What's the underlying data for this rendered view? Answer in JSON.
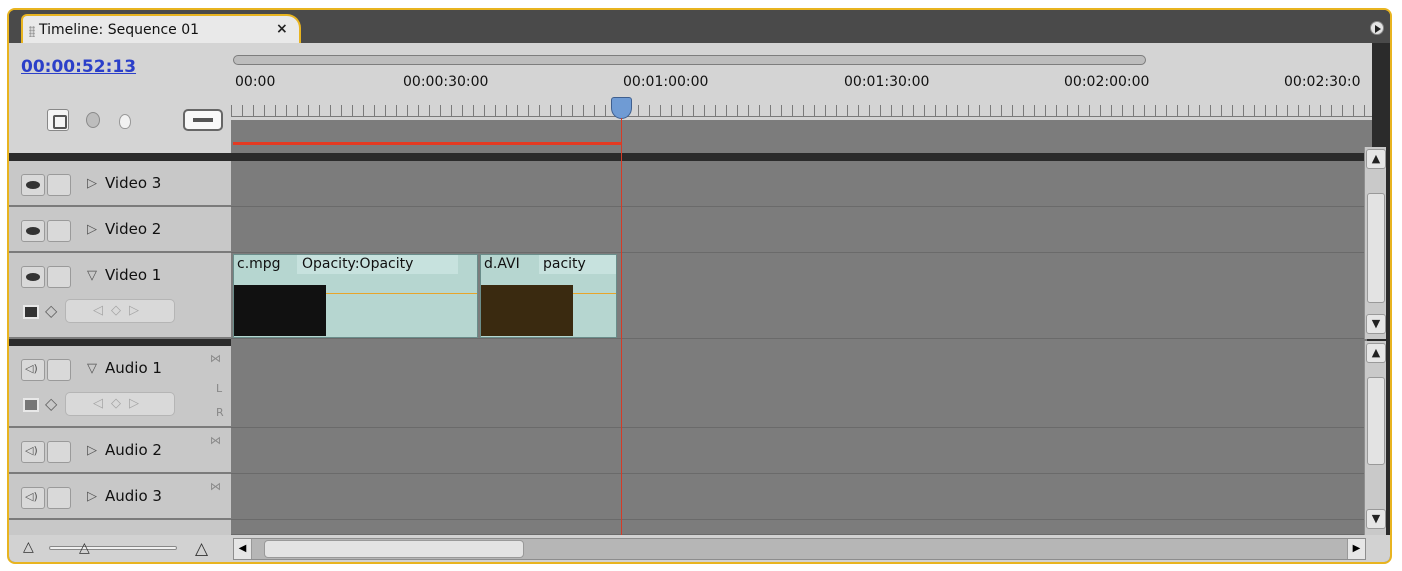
{
  "panel": {
    "tab_title": "Timeline: Sequence 01",
    "tab_close": "×"
  },
  "header": {
    "timecode": "00:00:52:13"
  },
  "ruler": {
    "ticks": [
      "00:00",
      "00:00:30:00",
      "00:01:00:00",
      "00:01:30:00",
      "00:02:00:00",
      "00:02:30:0"
    ]
  },
  "tracks": {
    "video3": {
      "label": "Video 3"
    },
    "video2": {
      "label": "Video 2"
    },
    "video1": {
      "label": "Video 1"
    },
    "audio1": {
      "label": "Audio 1",
      "l": "L",
      "r": "R"
    },
    "audio2": {
      "label": "Audio 2"
    },
    "audio3": {
      "label": "Audio 3"
    }
  },
  "clips": {
    "clip1": {
      "name": "c.mpg",
      "fx": "Opacity:Opacity"
    },
    "clip2": {
      "name": "d.AVI",
      "fx": "pacity"
    }
  },
  "colors": {
    "accent": "#e8b420",
    "timecode": "#2b3fc9",
    "playhead": "#6f9bd4",
    "render_bar": "#e43a22"
  }
}
